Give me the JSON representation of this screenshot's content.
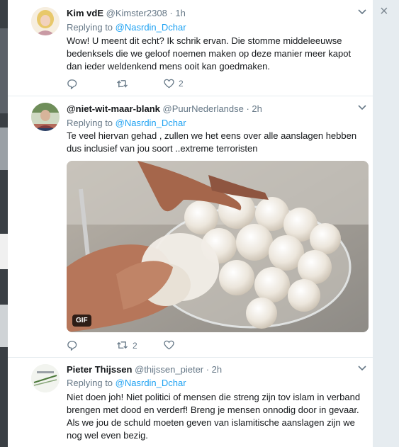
{
  "close_glyph": "×",
  "tweets": [
    {
      "name": "Kim vdE",
      "handle": "@Kimster2308 · 1h",
      "replying_prefix": "Replying to",
      "replying_to": "@Nasrdin_Dchar",
      "text": "Wow! U meent dit echt? Ik schrik ervan. Die stomme middeleeuwse bedenksels die we geloof noemen maken op deze manier meer kapot dan ieder weldenkend mens ooit kan goedmaken.",
      "retweets": "",
      "likes": "2"
    },
    {
      "name": "@niet-wit-maar-blank",
      "handle": "@PuurNederlandse · 2h",
      "replying_prefix": "Replying to",
      "replying_to": "@Nasrdin_Dchar",
      "text": "Te veel hiervan gehad , zullen we het eens over alle aanslagen hebben dus inclusief van jou soort ..extreme  terroristen",
      "media_badge": "GIF",
      "retweets": "2",
      "likes": ""
    },
    {
      "name": "Pieter Thijssen",
      "handle": "@thijssen_pieter · 2h",
      "replying_prefix": "Replying to",
      "replying_to": "@Nasrdin_Dchar",
      "text": "Niet doen joh! Niet politici of mensen die streng zijn tov islam in verband brengen met dood en verderf! Breng je mensen onnodig door in gevaar. Als we jou de schuld moeten geven van islamitische aanslagen zijn we nog wel even bezig."
    }
  ],
  "colors": {
    "link": "#1da1f2",
    "muted": "#657786",
    "text": "#14171a"
  },
  "icons": [
    "chevron-down-icon",
    "reply-icon",
    "retweet-icon",
    "heart-icon",
    "close-icon"
  ]
}
